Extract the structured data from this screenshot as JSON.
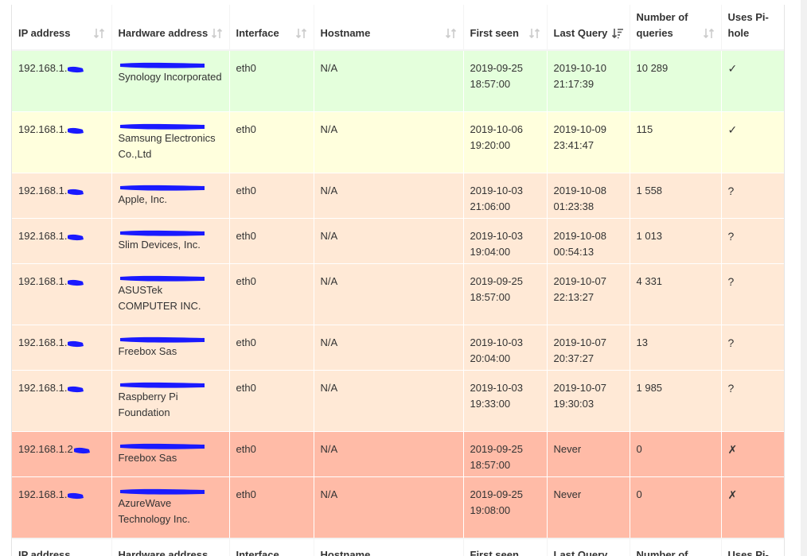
{
  "columns": [
    {
      "label": "IP address",
      "sort": "both"
    },
    {
      "label": "Hardware address",
      "sort": "both"
    },
    {
      "label": "Interface",
      "sort": "both"
    },
    {
      "label": "Hostname",
      "sort": "both"
    },
    {
      "label": "First seen",
      "sort": "both"
    },
    {
      "label": "Last Query",
      "sort": "desc"
    },
    {
      "label": "Number of queries",
      "sort": "both"
    },
    {
      "label": "Uses Pi-hole",
      "sort": "none"
    }
  ],
  "rows": [
    {
      "status": "green",
      "ip": "192.168.1.",
      "vendor": "Synology Incorporated",
      "interface": "eth0",
      "hostname": "N/A",
      "first_seen": "2019-09-25 18:57:00",
      "last_query": "2019-10-10 21:17:39",
      "queries": "10 289",
      "uses": "✓"
    },
    {
      "status": "yellow",
      "ip": "192.168.1.",
      "vendor": "Samsung Electronics Co.,Ltd",
      "interface": "eth0",
      "hostname": "N/A",
      "first_seen": "2019-10-06 19:20:00",
      "last_query": "2019-10-09 23:41:47",
      "queries": "115",
      "uses": "✓"
    },
    {
      "status": "orange",
      "ip": "192.168.1.",
      "vendor": "Apple, Inc.",
      "interface": "eth0",
      "hostname": "N/A",
      "first_seen": "2019-10-03 21:06:00",
      "last_query": "2019-10-08 01:23:38",
      "queries": "1 558",
      "uses": "?"
    },
    {
      "status": "orange",
      "ip": "192.168.1.",
      "vendor": "Slim Devices, Inc.",
      "interface": "eth0",
      "hostname": "N/A",
      "first_seen": "2019-10-03 19:04:00",
      "last_query": "2019-10-08 00:54:13",
      "queries": "1 013",
      "uses": "?"
    },
    {
      "status": "orange",
      "ip": "192.168.1.",
      "vendor": "ASUSTek COMPUTER INC.",
      "interface": "eth0",
      "hostname": "N/A",
      "first_seen": "2019-09-25 18:57:00",
      "last_query": "2019-10-07 22:13:27",
      "queries": "4 331",
      "uses": "?"
    },
    {
      "status": "orange",
      "ip": "192.168.1.",
      "vendor": "Freebox Sas",
      "interface": "eth0",
      "hostname": "N/A",
      "first_seen": "2019-10-03 20:04:00",
      "last_query": "2019-10-07 20:37:27",
      "queries": "13",
      "uses": "?"
    },
    {
      "status": "orange",
      "ip": "192.168.1.",
      "vendor": "Raspberry Pi Foundation",
      "interface": "eth0",
      "hostname": "N/A",
      "first_seen": "2019-10-03 19:33:00",
      "last_query": "2019-10-07 19:30:03",
      "queries": "1 985",
      "uses": "?"
    },
    {
      "status": "red",
      "ip": "192.168.1.2",
      "vendor": "Freebox Sas",
      "interface": "eth0",
      "hostname": "N/A",
      "first_seen": "2019-09-25 18:57:00",
      "last_query": "Never",
      "queries": "0",
      "uses": "✗"
    },
    {
      "status": "red",
      "ip": "192.168.1.",
      "vendor": "AzureWave Technology Inc.",
      "interface": "eth0",
      "hostname": "N/A",
      "first_seen": "2019-09-25 19:08:00",
      "last_query": "Never",
      "queries": "0",
      "uses": "✗"
    }
  ],
  "footer": {
    "ip": "IP address",
    "hw": "Hardware address",
    "interface": "Interface",
    "hostname": "Hostname",
    "first_seen": "First seen",
    "last_query": "Last Query",
    "queries": "Number of",
    "uses": "Uses Pi-"
  },
  "colors": {
    "green": "#e4ffdc",
    "yellow": "#ffffdd",
    "orange": "#ffe9d6",
    "red": "#ffbba7",
    "redaction": "#1a1aff"
  },
  "icons": {
    "sort_both": "sort-both-icon",
    "sort_desc": "sort-desc-icon",
    "redaction": "redaction-mark"
  }
}
